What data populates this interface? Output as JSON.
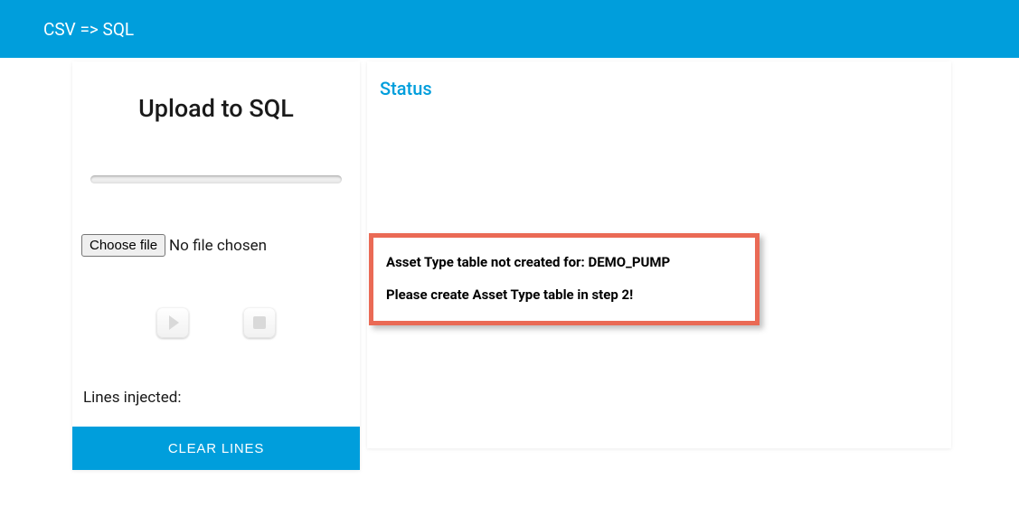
{
  "topbar": {
    "title": "CSV => SQL"
  },
  "left": {
    "title": "Upload to SQL",
    "choose_file_label": "Choose file",
    "file_status": "No file chosen",
    "lines_label": "Lines injected:",
    "clear_button": "CLEAR LINES"
  },
  "right": {
    "status_heading": "Status",
    "error_line1": "Asset Type table not created for: DEMO_PUMP",
    "error_line2": "Please create Asset Type table in step 2!"
  }
}
